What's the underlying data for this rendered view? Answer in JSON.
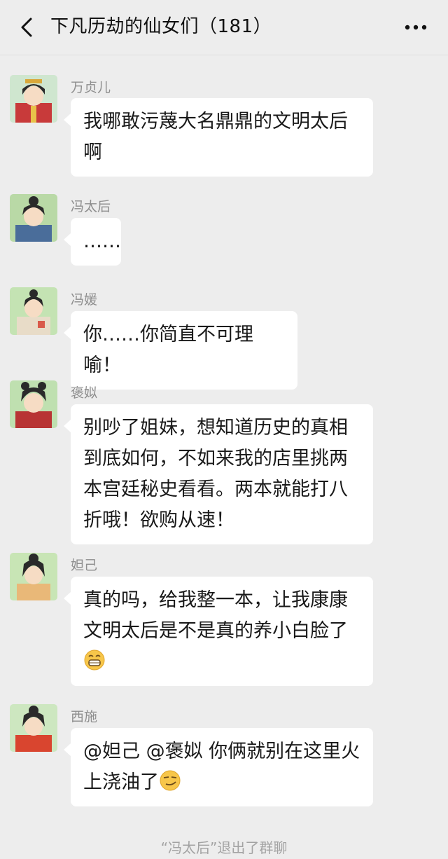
{
  "header": {
    "title": "下凡历劫的仙女们（181）",
    "back_icon": "chevron-left-icon",
    "more_icon": "more-dots-icon"
  },
  "messages": [
    {
      "sender": "万贞儿",
      "text": "我哪敢污蔑大名鼎鼎的文明太后啊"
    },
    {
      "sender": "冯太后",
      "text": "……"
    },
    {
      "sender": "冯媛",
      "text": "你……你简直不可理喻！"
    },
    {
      "sender": "褒姒",
      "text": "别吵了姐妹，想知道历史的真相到底如何，不如来我的店里挑两本宫廷秘史看看。两本就能打八折哦！欲购从速！"
    },
    {
      "sender": "妲己",
      "text": "真的吗，给我整一本，让我康康文明太后是不是真的养小白脸了",
      "emoji": "grin-emoji"
    },
    {
      "sender": "西施",
      "text": "@妲己 @褒姒 你俩就别在这里火上浇油了",
      "emoji": "smirk-emoji"
    }
  ],
  "system_notice": "“冯太后”退出了群聊",
  "colors": {
    "background": "#ededed",
    "bubble": "#ffffff",
    "sender_name": "#8e8e8e",
    "notice": "#a3a3a3"
  }
}
